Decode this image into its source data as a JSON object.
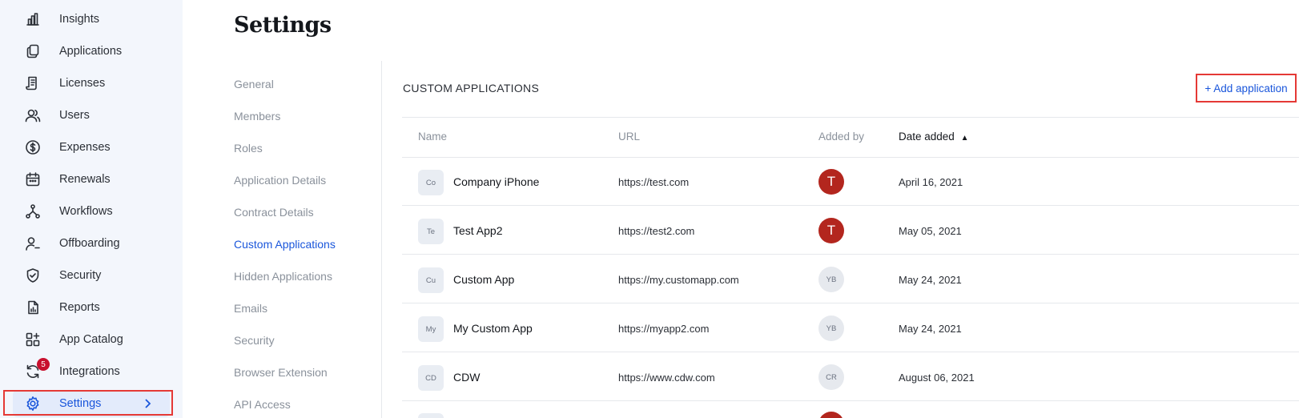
{
  "sidebar": {
    "items": [
      {
        "label": "Insights",
        "icon": "bar-chart-icon"
      },
      {
        "label": "Applications",
        "icon": "copy-icon"
      },
      {
        "label": "Licenses",
        "icon": "document-icon"
      },
      {
        "label": "Users",
        "icon": "users-icon"
      },
      {
        "label": "Expenses",
        "icon": "dollar-icon"
      },
      {
        "label": "Renewals",
        "icon": "calendar-icon"
      },
      {
        "label": "Workflows",
        "icon": "workflow-icon"
      },
      {
        "label": "Offboarding",
        "icon": "user-minus-icon"
      },
      {
        "label": "Security",
        "icon": "shield-icon"
      },
      {
        "label": "Reports",
        "icon": "report-icon"
      },
      {
        "label": "App Catalog",
        "icon": "grid-plus-icon"
      },
      {
        "label": "Integrations",
        "icon": "sync-icon",
        "badge": "5"
      },
      {
        "label": "Settings",
        "icon": "gear-icon",
        "active": true
      }
    ]
  },
  "page": {
    "title": "Settings"
  },
  "settings_nav": {
    "items": [
      {
        "label": "General"
      },
      {
        "label": "Members"
      },
      {
        "label": "Roles"
      },
      {
        "label": "Application Details"
      },
      {
        "label": "Contract Details"
      },
      {
        "label": "Custom Applications",
        "active": true
      },
      {
        "label": "Hidden Applications"
      },
      {
        "label": "Emails"
      },
      {
        "label": "Security"
      },
      {
        "label": "Browser Extension"
      },
      {
        "label": "API Access"
      }
    ]
  },
  "main": {
    "section_title": "CUSTOM APPLICATIONS",
    "add_button": "+ Add application",
    "columns": {
      "name": "Name",
      "url": "URL",
      "added_by": "Added by",
      "date_added": "Date added",
      "sort_indicator": "▲"
    },
    "rows": [
      {
        "icon_text": "Co",
        "name": "Company iPhone",
        "url": "https://test.com",
        "added_by": "T",
        "avatar_type": "photo",
        "date": "April 16, 2021"
      },
      {
        "icon_text": "Te",
        "name": "Test App2",
        "url": "https://test2.com",
        "added_by": "T",
        "avatar_type": "photo",
        "date": "May 05, 2021"
      },
      {
        "icon_text": "Cu",
        "name": "Custom App",
        "url": "https://my.customapp.com",
        "added_by": "YB",
        "avatar_type": "initials",
        "date": "May 24, 2021"
      },
      {
        "icon_text": "My",
        "name": "My Custom App",
        "url": "https://myapp2.com",
        "added_by": "YB",
        "avatar_type": "initials",
        "date": "May 24, 2021"
      },
      {
        "icon_text": "CD",
        "name": "CDW",
        "url": "https://www.cdw.com",
        "added_by": "CR",
        "avatar_type": "initials",
        "date": "August 06, 2021"
      }
    ]
  },
  "colors": {
    "accent": "#1a56db",
    "highlight": "#e53935",
    "sidebar_bg": "#f3f6fc",
    "avatar_red": "#b3261e",
    "badge": "#c8102e"
  }
}
